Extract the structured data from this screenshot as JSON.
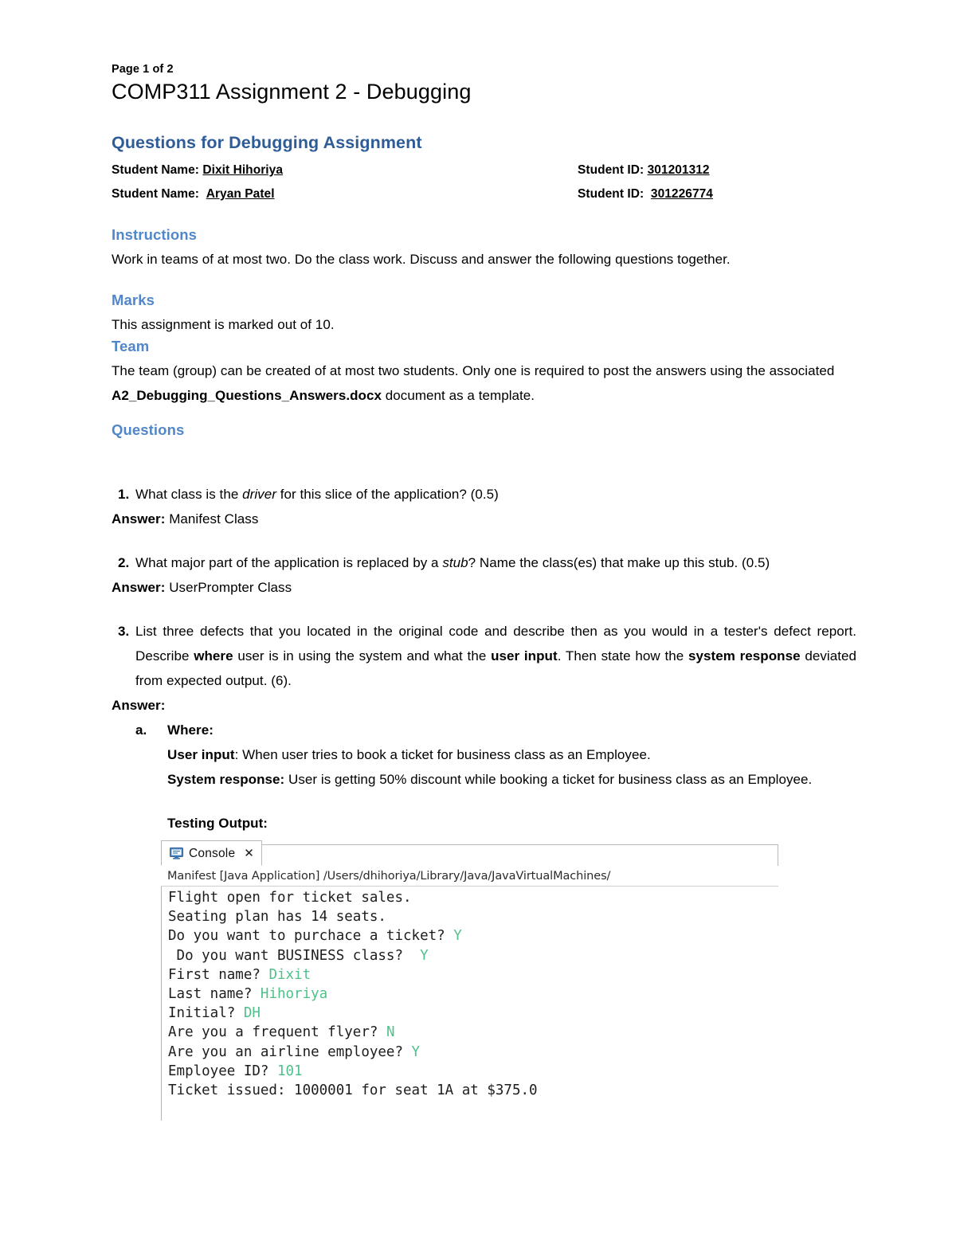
{
  "document": {
    "page_number": "Page 1 of 2",
    "title": "COMP311 Assignment 2 - Debugging",
    "section_heading": "Questions for Debugging Assignment"
  },
  "students": [
    {
      "name_label": "Student Name: ",
      "name": "Dixit Hihoriya",
      "id_label": "Student ID: ",
      "id": "301201312"
    },
    {
      "name_label": "Student Name:  ",
      "name": "Aryan Patel",
      "id_label": "Student ID:  ",
      "id": "301226774"
    }
  ],
  "sections": {
    "instructions": {
      "heading": "Instructions",
      "text": " Work in teams of at most two.  Do the class work. Discuss and answer the following questions together."
    },
    "marks": {
      "heading": "Marks",
      "text": "This assignment is marked out of 10."
    },
    "team": {
      "heading": "Team",
      "text_before": "The team (group) can be created of at most two students. Only one is required to post the answers using the associated ",
      "bold_filename": "A2_Debugging_Questions_Answers.docx",
      "text_after": " document as a template."
    },
    "questions": {
      "heading": "Questions"
    }
  },
  "questions": [
    {
      "number": "1.",
      "text_a": "What class is the ",
      "italic": "driver",
      "text_b": " for this slice of the application? (0.5)",
      "answer_label": "Answer:",
      "answer_text": " Manifest Class"
    },
    {
      "number": "2.",
      "text_a": "What major part of the application is replaced by a ",
      "italic": "stub",
      "text_b": "? Name the class(es) that make up this stub. (0.5)",
      "answer_label": "Answer:",
      "answer_text": "  UserPrompter Class"
    }
  ],
  "question3": {
    "number": "3.",
    "part1": "List three defects that you located in the original code and describe then as you would in a tester's defect report. Describe ",
    "bold1": "where",
    "part2": " user is in using the system and what the ",
    "bold2": "user input",
    "part3": ". Then state how the ",
    "bold3": "system response",
    "part4": " deviated from expected output. (6).",
    "answer_label": "Answer:",
    "sub_marker": "a.",
    "sub_heading": "Where:",
    "user_input_label": "User input",
    "user_input_text": ": When user tries to book a ticket for business class as an Employee.",
    "system_response_label": "System response:",
    "system_response_text": " User is getting 50% discount while booking a ticket for business class as an Employee.",
    "testing_output_label": "Testing Output:"
  },
  "console": {
    "tab_label": "Console",
    "tab_icon": "console-monitor-icon",
    "close_icon": "close-icon",
    "launch_line": "Manifest [Java Application] /Users/dhihoriya/Library/Java/JavaVirtualMachines/",
    "lines": [
      {
        "text": "Flight open for ticket sales.",
        "input": ""
      },
      {
        "text": "Seating plan has 14 seats.",
        "input": ""
      },
      {
        "text": "Do you want to purchace a ticket? ",
        "input": "Y"
      },
      {
        "text": " Do you want BUSINESS class?  ",
        "input": "Y"
      },
      {
        "text": "First name? ",
        "input": "Dixit"
      },
      {
        "text": "Last name? ",
        "input": "Hihoriya"
      },
      {
        "text": "Initial? ",
        "input": "DH"
      },
      {
        "text": "Are you a frequent flyer? ",
        "input": "N"
      },
      {
        "text": "Are you an airline employee? ",
        "input": "Y"
      },
      {
        "text": "Employee ID? ",
        "input": "101"
      },
      {
        "text": "Ticket issued: 1000001 for seat 1A at $375.0",
        "input": ""
      }
    ]
  },
  "colors": {
    "heading_blue_dark": "#2F5C96",
    "heading_blue_light": "#5187C8",
    "console_input_green": "#52C08B",
    "console_icon_blue": "#3C78B4"
  }
}
